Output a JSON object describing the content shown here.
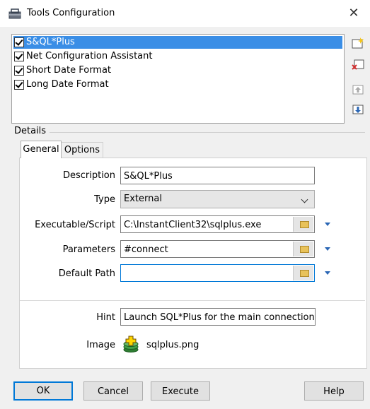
{
  "window": {
    "title": "Tools Configuration",
    "close_glyph": "✕"
  },
  "tools": [
    {
      "label": "S&QL*Plus",
      "checked": true,
      "selected": true
    },
    {
      "label": "Net Configuration Assistant",
      "checked": true,
      "selected": false
    },
    {
      "label": "Short Date Format",
      "checked": true,
      "selected": false
    },
    {
      "label": "Long Date Format",
      "checked": true,
      "selected": false
    }
  ],
  "side_buttons": [
    "new-tool-icon",
    "delete-tool-icon",
    "move-up-icon",
    "move-down-icon"
  ],
  "details": {
    "group_label": "Details",
    "tabs": {
      "general": "General",
      "options": "Options"
    },
    "fields": {
      "description": {
        "label": "Description",
        "value": "S&QL*Plus"
      },
      "type": {
        "label": "Type",
        "value": "External"
      },
      "executable": {
        "label": "Executable/Script",
        "value": "C:\\InstantClient32\\sqlplus.exe"
      },
      "parameters": {
        "label": "Parameters",
        "value": "#connect"
      },
      "default_path": {
        "label": "Default Path",
        "value": ""
      },
      "hint": {
        "label": "Hint",
        "value": "Launch SQL*Plus for the main connection"
      },
      "image": {
        "label": "Image",
        "file": "sqlplus.png"
      }
    }
  },
  "buttons": {
    "ok": "OK",
    "cancel": "Cancel",
    "execute": "Execute",
    "help": "Help"
  },
  "colors": {
    "selection": "#3a8ee6",
    "focus": "#0078d7"
  }
}
